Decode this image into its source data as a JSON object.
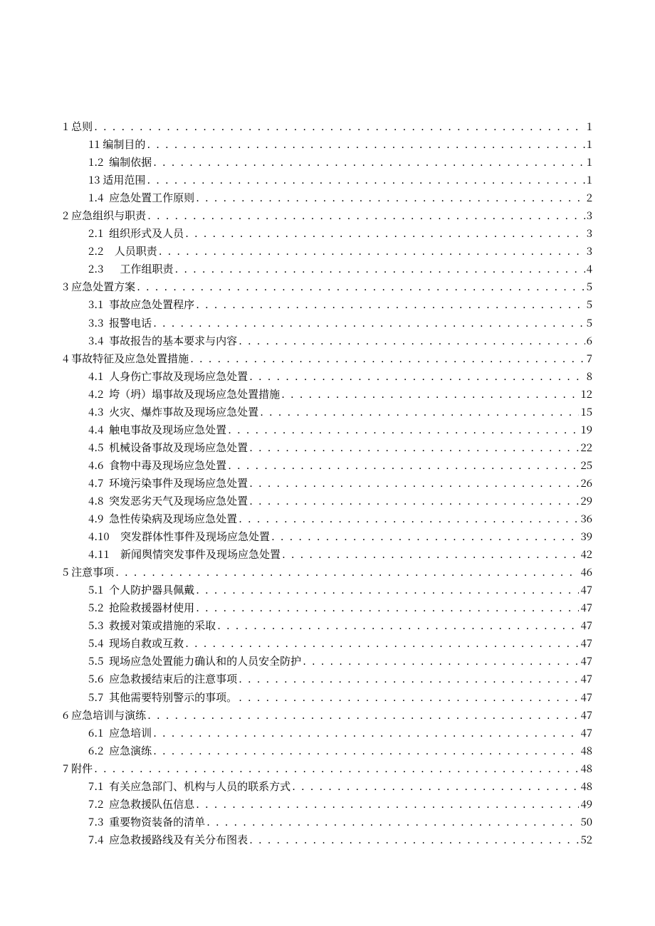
{
  "toc": [
    {
      "level": 1,
      "number": "1",
      "gap": " ",
      "title": "总则",
      "page": "1"
    },
    {
      "level": 2,
      "number": "11",
      "gap": " ",
      "title": "编制目的",
      "page": "1"
    },
    {
      "level": 2,
      "number": "1.2",
      "gap": "  ",
      "title": "编制依据",
      "page": "1"
    },
    {
      "level": 2,
      "number": "13",
      "gap": " ",
      "title": "适用范围",
      "page": "1"
    },
    {
      "level": 2,
      "number": "1.4",
      "gap": "  ",
      "title": "应急处置工作原则",
      "page": "2"
    },
    {
      "level": 1,
      "number": "2",
      "gap": " ",
      "title": "应急组织与职责",
      "page": "3"
    },
    {
      "level": 2,
      "number": "2.1",
      "gap": "  ",
      "title": "组织形式及人员",
      "page": "3"
    },
    {
      "level": 2,
      "number": "2.2",
      "gap": "    ",
      "title": "人员职责",
      "page": "3"
    },
    {
      "level": 2,
      "number": "2.3",
      "gap": "      ",
      "title": "工作组职责",
      "page": "4"
    },
    {
      "level": 1,
      "number": "3",
      "gap": " ",
      "title": "应急处置方案",
      "page": "5"
    },
    {
      "level": 2,
      "number": "3.1",
      "gap": "  ",
      "title": "事故应急处置程序",
      "page": "5"
    },
    {
      "level": 2,
      "number": "3.3",
      "gap": "  ",
      "title": "报警电话",
      "page": "5"
    },
    {
      "level": 2,
      "number": "3.4",
      "gap": "  ",
      "title": "事故报告的基本要求与内容",
      "page": "6"
    },
    {
      "level": 1,
      "number": "4",
      "gap": " ",
      "title": "事故特征及应急处置措施",
      "page": "7"
    },
    {
      "level": 2,
      "number": "4.1",
      "gap": "  ",
      "title": "人身伤亡事故及现场应急处置",
      "page": "8"
    },
    {
      "level": 2,
      "number": "4.2",
      "gap": "  ",
      "title": "垮（坍）塌事故及现场应急处置措施",
      "page": "12"
    },
    {
      "level": 2,
      "number": "4.3",
      "gap": "  ",
      "title": "火灾、爆炸事故及现场应急处置",
      "page": "15"
    },
    {
      "level": 2,
      "number": "4.4",
      "gap": "  ",
      "title": "触电事故及现场应急处置",
      "page": "19"
    },
    {
      "level": 2,
      "number": "4.5",
      "gap": "  ",
      "title": "机械设备事故及现场应急处置",
      "page": "22"
    },
    {
      "level": 2,
      "number": "4.6",
      "gap": "  ",
      "title": "食物中毒及现场应急处置",
      "page": "25"
    },
    {
      "level": 2,
      "number": "4.7",
      "gap": "  ",
      "title": "环境污染事件及现场应急处置",
      "page": "26"
    },
    {
      "level": 2,
      "number": "4.8",
      "gap": "  ",
      "title": "突发恶劣天气及现场应急处置",
      "page": "29"
    },
    {
      "level": 2,
      "number": "4.9",
      "gap": "  ",
      "title": "急性传染病及现场应急处置",
      "page": "36"
    },
    {
      "level": 2,
      "number": "4.10",
      "gap": "    ",
      "title": "突发群体性事件及现场应急处置",
      "page": "39"
    },
    {
      "level": 2,
      "number": "4.11",
      "gap": "    ",
      "title": "新闻舆情突发事件及现场应急处置",
      "page": "42"
    },
    {
      "level": 1,
      "number": "5",
      "gap": " ",
      "title": "注意事项",
      "page": "46"
    },
    {
      "level": 2,
      "number": "5.1",
      "gap": "  ",
      "title": "个人防护器具佩戴",
      "page": "47"
    },
    {
      "level": 2,
      "number": "5.2",
      "gap": "  ",
      "title": "抢险救援器材使用",
      "page": "47"
    },
    {
      "level": 2,
      "number": "5.3",
      "gap": "  ",
      "title": "救援对策或措施的采取",
      "page": "47"
    },
    {
      "level": 2,
      "number": "5.4",
      "gap": "  ",
      "title": "现场自救或互救",
      "page": "47"
    },
    {
      "level": 2,
      "number": "5.5",
      "gap": "  ",
      "title": "现场应急处置能力确认和的人员安全防护",
      "page": "47"
    },
    {
      "level": 2,
      "number": "5.6",
      "gap": "  ",
      "title": "应急救援结束后的注意事项",
      "page": "47"
    },
    {
      "level": 2,
      "number": "5.7",
      "gap": "  ",
      "title": "其他需要特别警示的事项。",
      "page": "47"
    },
    {
      "level": 1,
      "number": "6",
      "gap": " ",
      "title": "应急培训与演练",
      "page": "47"
    },
    {
      "level": 2,
      "number": "6.1",
      "gap": "  ",
      "title": "应急培训",
      "page": "47"
    },
    {
      "level": 2,
      "number": "6.2",
      "gap": "  ",
      "title": "应急演练",
      "page": "48"
    },
    {
      "level": 1,
      "number": "7",
      "gap": " ",
      "title": "附件",
      "page": "48"
    },
    {
      "level": 2,
      "number": "7.1",
      "gap": "  ",
      "title": "有关应急部门、机构与人员的联系方式",
      "page": "48"
    },
    {
      "level": 2,
      "number": "7.2",
      "gap": "  ",
      "title": "应急救援队伍信息",
      "page": "49"
    },
    {
      "level": 2,
      "number": "7.3",
      "gap": "  ",
      "title": "重要物资装备的清单",
      "page": "50"
    },
    {
      "level": 2,
      "number": "7.4",
      "gap": "  ",
      "title": "应急救援路线及有关分布图表",
      "page": "52"
    }
  ]
}
